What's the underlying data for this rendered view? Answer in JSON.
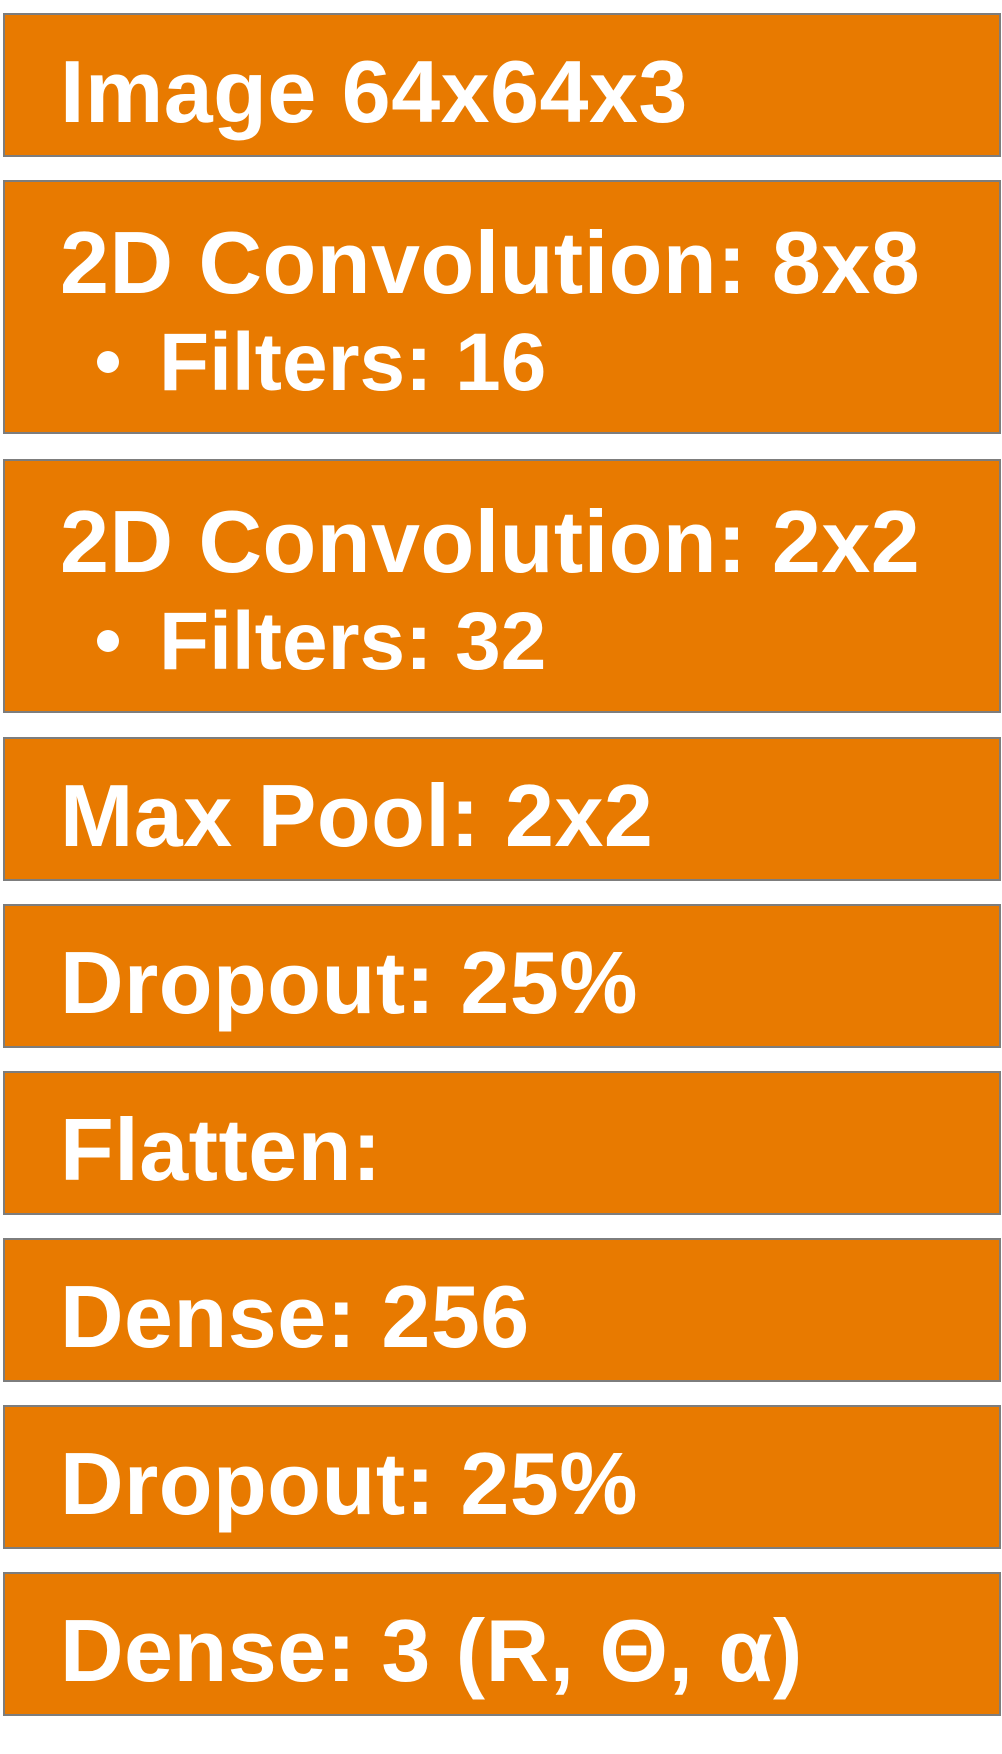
{
  "colors": {
    "box_fill": "#e87a00",
    "box_border": "#7d7d7d",
    "text": "#ffffff",
    "background": "#ffffff"
  },
  "layers": [
    {
      "title": "Image 64x64x3"
    },
    {
      "title": "2D Convolution: 8x8",
      "bullet": "Filters: 16"
    },
    {
      "title": "2D Convolution: 2x2",
      "bullet": "Filters: 32"
    },
    {
      "title": "Max Pool: 2x2"
    },
    {
      "title": "Dropout: 25%"
    },
    {
      "title": "Flatten:"
    },
    {
      "title": "Dense: 256"
    },
    {
      "title": "Dropout: 25%"
    },
    {
      "title": "Dense: 3 (R, Θ, α)"
    }
  ]
}
